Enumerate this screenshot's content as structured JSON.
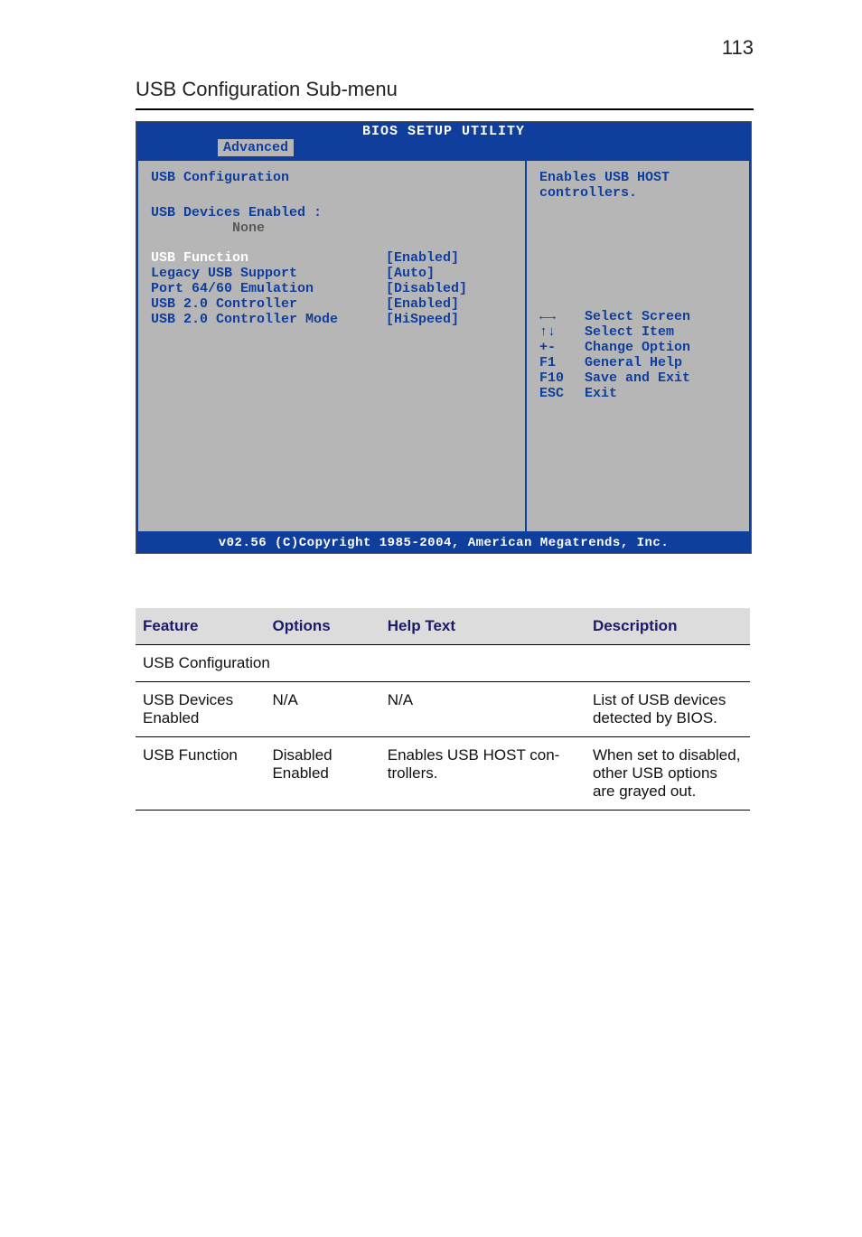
{
  "page_number": "113",
  "section_title": "USB Configuration Sub-menu",
  "bios": {
    "title": "BIOS SETUP UTILITY",
    "tab": "Advanced",
    "left": {
      "heading": "USB Configuration",
      "devices_label": "USB Devices Enabled :",
      "devices_value": "None",
      "rows": [
        {
          "label": "USB Function",
          "value": "[Enabled]",
          "highlight": true
        },
        {
          "label": "Legacy USB Support",
          "value": "[Auto]"
        },
        {
          "label": "Port 64/60 Emulation",
          "value": "[Disabled]"
        },
        {
          "label": "USB 2.0 Controller",
          "value": "[Enabled]"
        },
        {
          "label": "USB 2.0 Controller Mode",
          "value": "[HiSpeed]"
        }
      ]
    },
    "right": {
      "help_text_1": "Enables USB HOST",
      "help_text_2": "controllers.",
      "keys": [
        {
          "k": "←→",
          "t": "Select Screen"
        },
        {
          "k": "↑↓",
          "t": "Select Item"
        },
        {
          "k": "+-",
          "t": "Change Option"
        },
        {
          "k": "F1",
          "t": "General Help"
        },
        {
          "k": "F10",
          "t": "Save and Exit"
        },
        {
          "k": "ESC",
          "t": "Exit"
        }
      ]
    },
    "footer": "v02.56 (C)Copyright 1985-2004, American Megatrends, Inc."
  },
  "table": {
    "headers": {
      "feature": "Feature",
      "options": "Options",
      "help": "Help Text",
      "desc": "Description"
    },
    "subheading": "USB Configuration",
    "rows": [
      {
        "feature": "USB Devices Enabled",
        "options": "N/A",
        "help": "N/A",
        "desc": "List of USB devices detected by BIOS."
      },
      {
        "feature": "USB Func­tion",
        "options": "Disabled\nEnabled",
        "help": "Enables USB HOST con­trollers.",
        "desc": "When set to dis­abled, other USB options are grayed out."
      }
    ]
  }
}
